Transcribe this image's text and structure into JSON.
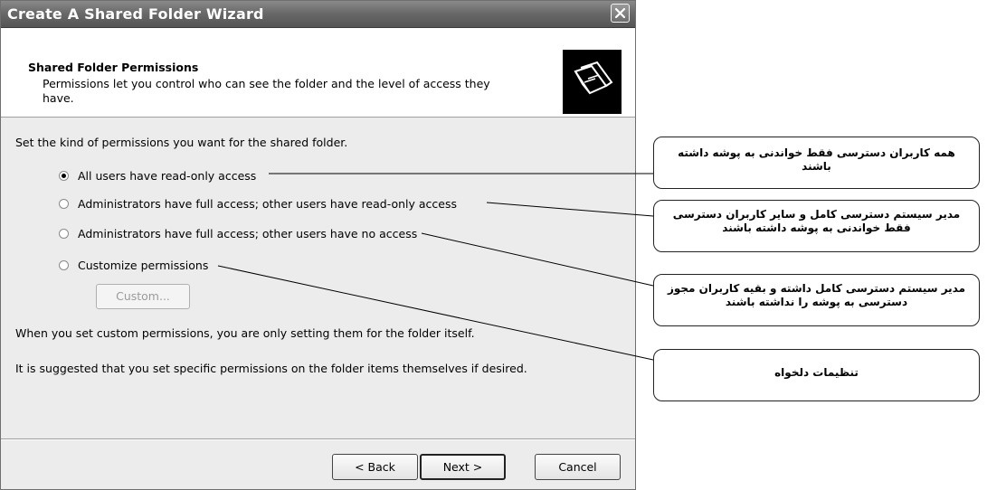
{
  "window": {
    "title": "Create A Shared Folder Wizard",
    "close_icon": "close-icon"
  },
  "header": {
    "title": "Shared Folder Permissions",
    "description": "Permissions let you control who can see the folder and the level of access they have.",
    "icon": "shared-folder-icon"
  },
  "body": {
    "instruction": "Set the kind of permissions you want for the shared folder.",
    "options": [
      {
        "label": "All users have read-only access",
        "selected": true
      },
      {
        "label": "Administrators have full access; other users have read-only access",
        "selected": false
      },
      {
        "label": "Administrators have full access; other users have no access",
        "selected": false
      },
      {
        "label": "Customize permissions",
        "selected": false
      }
    ],
    "custom_button": "Custom...",
    "note_1": "When you set custom permissions, you are only setting them for the folder itself.",
    "note_2": "It is suggested that you set specific permissions on the folder items themselves if desired."
  },
  "footer": {
    "back": "< Back",
    "next": "Next >",
    "cancel": "Cancel"
  },
  "callouts": [
    "همه کاربران دسترسی فقط خواندنی به پوشه داشته باشند",
    "مدیر سیستم دسترسی کامل و سایر کاربران دسترسی فقط خواندنی به پوشه داشته باشند",
    "مدیر سیستم دسترسی کامل داشته و بقیه کاربران مجوز دسترسی به پوشه را نداشته باشند",
    "تنظیمات دلخواه"
  ]
}
